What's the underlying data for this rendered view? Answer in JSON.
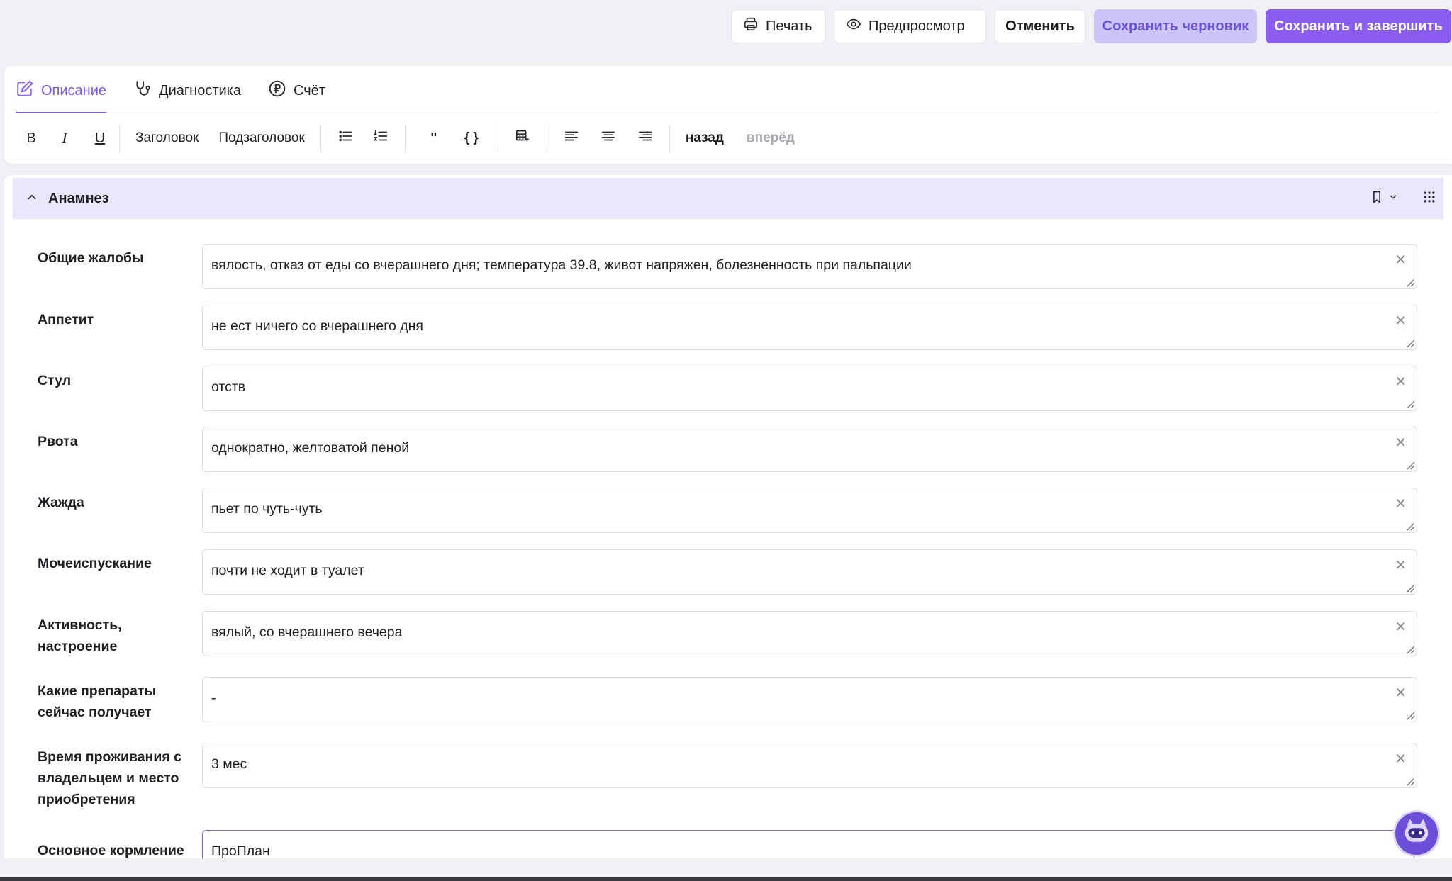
{
  "actions": {
    "print": "Печать",
    "preview": "Предпросмотр",
    "cancel": "Отменить",
    "save_draft": "Сохранить черновик",
    "save_finish": "Сохранить и завершить"
  },
  "tabs": [
    {
      "label": "Описание",
      "icon": "edit-icon",
      "active": true
    },
    {
      "label": "Диагностика",
      "icon": "stethoscope-icon",
      "active": false
    },
    {
      "label": "Счёт",
      "icon": "ruble-icon",
      "active": false
    }
  ],
  "toolbar": {
    "bold": "B",
    "italic": "I",
    "underline": "U",
    "heading": "Заголовок",
    "subheading": "Подзаголовок",
    "quote": "\"",
    "code": "{ }",
    "undo": "назад",
    "redo": "вперёд"
  },
  "section": {
    "title": "Анамнез",
    "rows": [
      {
        "label": "Общие жалобы",
        "value": "вялость, отказ от еды со вчерашнего дня; температура 39.8, живот напряжен, болезненность при пальпации"
      },
      {
        "label": "Аппетит",
        "value": "не ест ничего со вчерашнего дня"
      },
      {
        "label": "Стул",
        "value": "отств"
      },
      {
        "label": "Рвота",
        "value": "однократно, желтоватой пеной"
      },
      {
        "label": "Жажда",
        "value": "пьет по чуть-чуть"
      },
      {
        "label": "Мочеиспускание",
        "value": "почти не ходит в туалет"
      },
      {
        "label": "Активность, настроение",
        "value": "вялый, со вчерашнего вечера"
      },
      {
        "label": "Какие препараты сейчас получает",
        "value": "-"
      },
      {
        "label": "Время проживания с владельцем и место приобретения",
        "value": "3 мес"
      },
      {
        "label": "Основное кормление",
        "value": "ПроПлан"
      }
    ]
  },
  "colors": {
    "accent": "#8b5cf0",
    "accent_soft": "#cbc6f7",
    "section_header_bg": "#e9e7fd"
  }
}
